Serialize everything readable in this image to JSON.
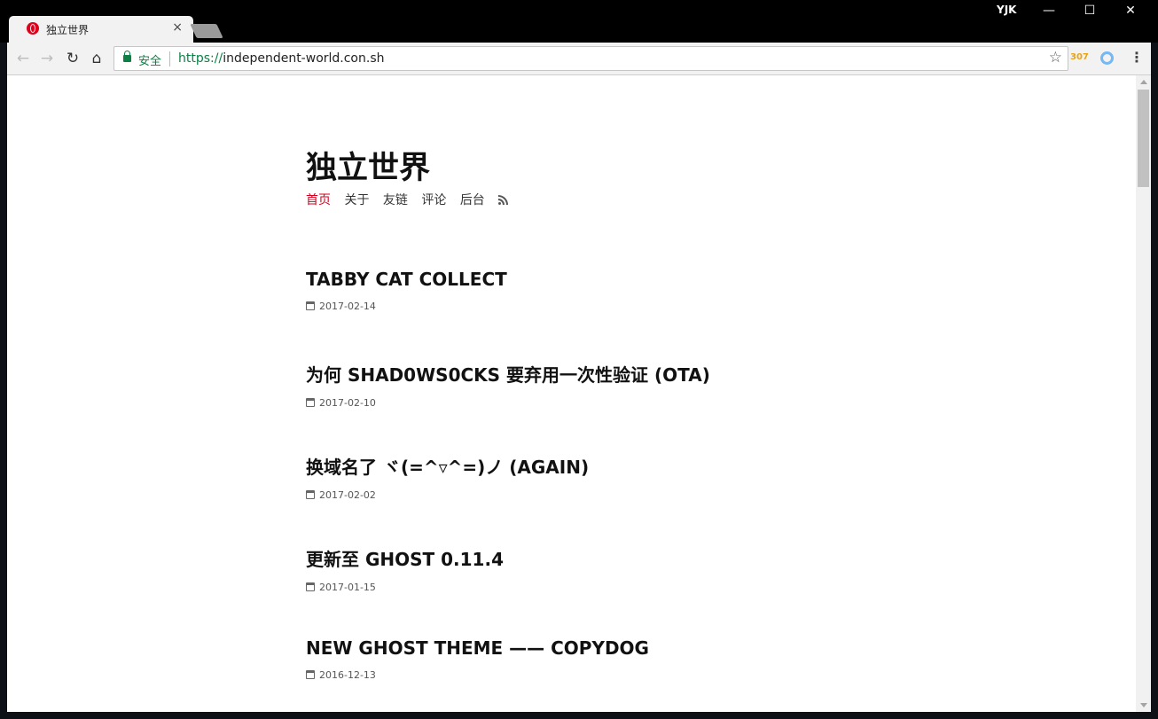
{
  "window": {
    "profile_name": "YJK",
    "minimize_glyph": "—",
    "maximize_glyph": "☐",
    "close_glyph": "✕"
  },
  "tab": {
    "title": "独立世界",
    "close_glyph": "×"
  },
  "toolbar": {
    "back_glyph": "←",
    "forward_glyph": "→",
    "reload_glyph": "↻",
    "home_glyph": "⌂",
    "secure_label": "安全",
    "url_scheme": "https://",
    "url_host": "independent-world.con.sh",
    "star_glyph": "☆",
    "extension_counter": "307",
    "menu_glyph": "⋮"
  },
  "site": {
    "title": "独立世界",
    "nav": [
      {
        "label": "首页",
        "active": true
      },
      {
        "label": "关于",
        "active": false
      },
      {
        "label": "友链",
        "active": false
      },
      {
        "label": "评论",
        "active": false
      },
      {
        "label": "后台",
        "active": false
      }
    ],
    "accent_color": "#d6001c"
  },
  "posts": [
    {
      "title": "TABBY CAT COLLECT",
      "date": "2017-02-14"
    },
    {
      "title": "为何 SHAD0WS0CKS 要弃用一次性验证 (OTA)",
      "date": "2017-02-10"
    },
    {
      "title": "换域名了 ヾ(=^▿^=)ノ (AGAIN)",
      "date": "2017-02-02"
    },
    {
      "title": "更新至 GHOST 0.11.4",
      "date": "2017-01-15"
    },
    {
      "title": "NEW GHOST THEME —— COPYDOG",
      "date": "2016-12-13"
    }
  ],
  "icons": {
    "favicon": "opera-icon",
    "rss": "rss-icon",
    "date": "calendar-icon"
  }
}
